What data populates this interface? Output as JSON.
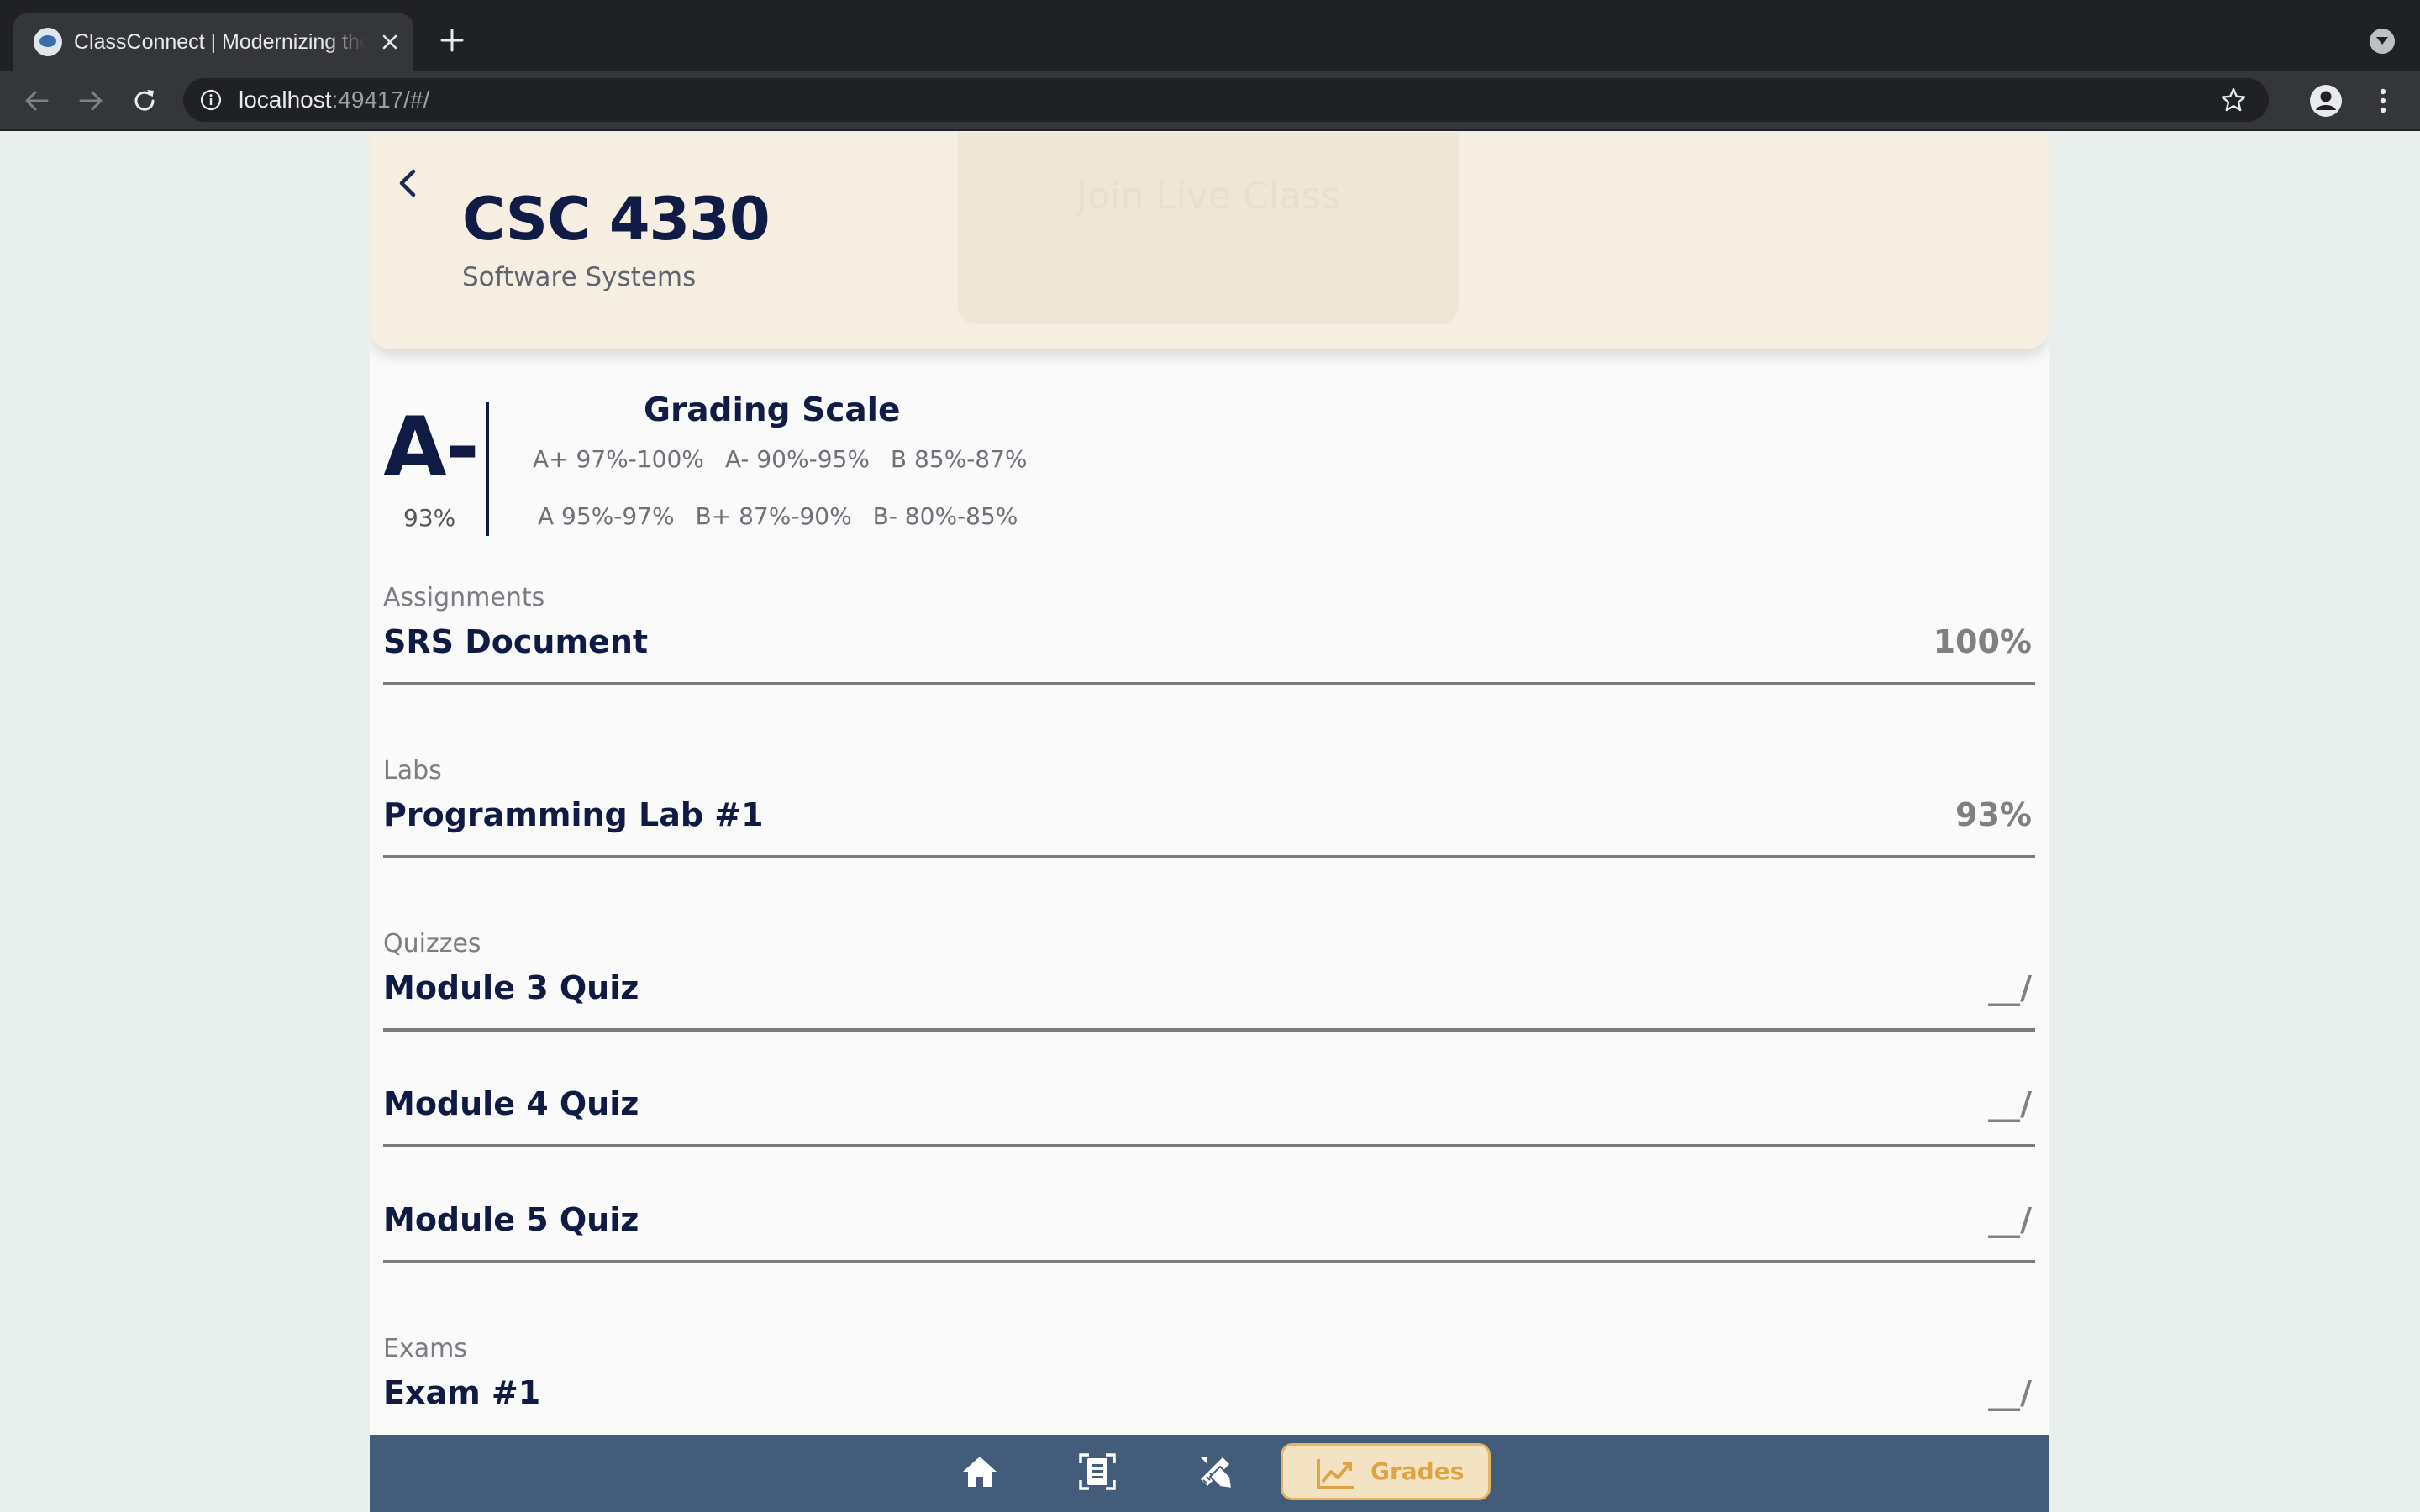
{
  "browser": {
    "tab_title": "ClassConnect | Modernizing the Classroom",
    "url_host": "localhost",
    "url_rest": ":49417/#/"
  },
  "course": {
    "code": "CSC 4330",
    "name": "Software Systems",
    "join_live_label": "Join Live Class"
  },
  "grade": {
    "letter": "A-",
    "percent": "93%"
  },
  "grading_scale": {
    "title": "Grading Scale",
    "row1": [
      "A+ 97%-100%",
      "A- 90%-95%",
      "B 85%-87%"
    ],
    "row2": [
      "A 95%-97%",
      "B+ 87%-90%",
      "B- 80%-85%"
    ]
  },
  "sections": [
    {
      "label": "Assignments",
      "items": [
        {
          "name": "SRS Document",
          "score": "100%"
        }
      ]
    },
    {
      "label": "Labs",
      "items": [
        {
          "name": "Programming Lab #1",
          "score": "93%"
        }
      ]
    },
    {
      "label": "Quizzes",
      "items": [
        {
          "name": "Module 3 Quiz",
          "score": "__/"
        },
        {
          "name": "Module 4 Quiz",
          "score": "__/"
        },
        {
          "name": "Module 5 Quiz",
          "score": "__/"
        }
      ]
    },
    {
      "label": "Exams",
      "items": [
        {
          "name": "Exam #1",
          "score": "__/"
        }
      ]
    }
  ],
  "bottom_nav": {
    "items": [
      {
        "icon": "home-icon"
      },
      {
        "icon": "document-icon"
      },
      {
        "icon": "pencil-ruler-icon"
      },
      {
        "icon": "chart-line-icon",
        "label": "Grades",
        "active": true
      }
    ]
  },
  "colors": {
    "navy": "#0f1b44",
    "header_bg": "#f6eee0",
    "nav_bg": "#435c7a",
    "active_tab_bg": "#f4e3c3",
    "active_tab_accent": "#dca445"
  }
}
